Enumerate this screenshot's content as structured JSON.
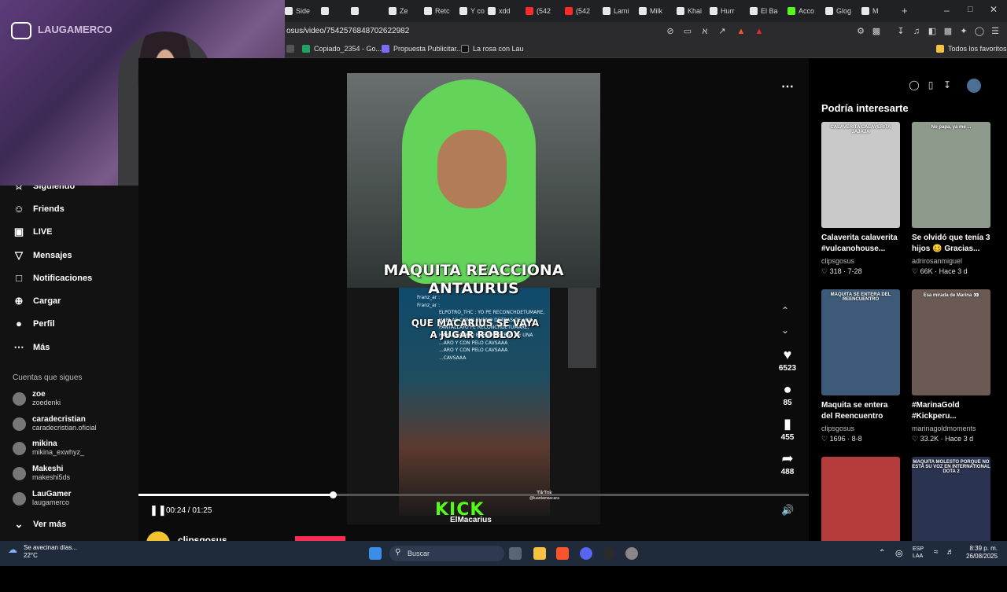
{
  "tabs": [
    {
      "label": "Side",
      "color": "#e8e8e8"
    },
    {
      "label": "",
      "color": "#e8e8e8"
    },
    {
      "label": "",
      "color": "#e8e8e8"
    },
    {
      "label": "Ze",
      "color": "#e8e8e8"
    },
    {
      "label": "Retc",
      "color": "#e8e8e8"
    },
    {
      "label": "Y co",
      "color": "#e8e8e8"
    },
    {
      "label": "xdd",
      "color": "#e8e8e8"
    },
    {
      "label": "(542",
      "color": "#ff2a2a"
    },
    {
      "label": "(542",
      "color": "#ff2a2a"
    },
    {
      "label": "Lami",
      "color": "#e8e8e8"
    },
    {
      "label": "Milk",
      "color": "#e8e8e8"
    },
    {
      "label": "Khai",
      "color": "#e8e8e8"
    },
    {
      "label": "Hurr",
      "color": "#e8e8e8"
    },
    {
      "label": "El Ba",
      "color": "#e8e8e8"
    },
    {
      "label": "Acco",
      "color": "#53fc18"
    },
    {
      "label": "Glog",
      "color": "#e8e8e8"
    },
    {
      "label": "M",
      "color": "#e8e8e8"
    }
  ],
  "browser": {
    "url": "osus/video/7542576848702622982",
    "bookmarks": [
      "Copiado_2354 - Go...",
      "Propuesta Publicitar...",
      "La rosa con Lau"
    ],
    "all_bookmarks": "Todos los favoritos"
  },
  "webcam": {
    "handle": "LAUGAMERCO"
  },
  "sidebar": {
    "partial_item": "Siguiendo",
    "items": [
      {
        "icon": "☺",
        "label": "Friends"
      },
      {
        "icon": "▣",
        "label": "LIVE"
      },
      {
        "icon": "▽",
        "label": "Mensajes"
      },
      {
        "icon": "□",
        "label": "Notificaciones"
      },
      {
        "icon": "⊕",
        "label": "Cargar"
      },
      {
        "icon": "●",
        "label": "Perfil"
      },
      {
        "icon": "⋯",
        "label": "Más"
      }
    ],
    "following_title": "Cuentas que sigues",
    "accounts": [
      {
        "name": "zoe",
        "handle": "zoedenki"
      },
      {
        "name": "caradecristian",
        "handle": "caradecristian.oficial"
      },
      {
        "name": "mikina",
        "handle": "mikina_exwhyz_"
      },
      {
        "name": "Makeshi",
        "handle": "makeshi5ds"
      },
      {
        "name": "LauGamer",
        "handle": "laugamerco"
      }
    ],
    "see_more": "Ver más"
  },
  "video": {
    "title_line1": "MAQUITA REACCIONA",
    "title_line2": "ANTAURUS",
    "subtitle_line1": "QUE MACARIUS SE VAYA",
    "subtitle_line2": "A JUGAR ROBLOX",
    "chat_lines": [
      "Franz_ar :",
      "Franz_ar :",
      "ELPOTRO_THC : YO PE RECONCHDETUMARE,",
      "HABLAS COMO BUENO DETRAS DE UNA",
      "PANTALLAYO PE RECONCHDETUMARE,",
      "HABLAS COMO BUENO DETRAS DE UNA",
      "...ARO Y CON PELO CAVSAAA",
      "...ARO Y CON PELO CAVSAAA",
      "...CAVSAAA"
    ],
    "kick_logo": "KICK",
    "streamer_name": "ElMacarius",
    "tiktok_mark": "TikTok",
    "tiktok_handle": "@luantamascara",
    "time": "00:24 / 01:25",
    "progress": 0.29
  },
  "actions": [
    {
      "icon": "♥",
      "count": "6523",
      "name": "like-button"
    },
    {
      "icon": "●",
      "count": "85",
      "name": "comment-button"
    },
    {
      "icon": "▮",
      "count": "455",
      "name": "save-button"
    },
    {
      "icon": "➦",
      "count": "488",
      "name": "share-button"
    }
  ],
  "channel": {
    "name": "clipsgosus"
  },
  "rail": {
    "title": "Podría interesarte",
    "cards": [
      {
        "caption": "Calaverita calaverita #vulcanohouse...",
        "author": "clipsgosus",
        "stats": "♡ 318 · 7-28",
        "thumb_text": "CALAVERITA CALAVERITA JAJAJA",
        "bg": "#c9c9c9"
      },
      {
        "caption": "Se olvidó que tenía 3 hijos 🥴 Gracias...",
        "author": "adrirosanmiguel",
        "stats": "♡ 66K · Hace 3 d",
        "thumb_text": "No papa, ya me ...",
        "bg": "#8e9a8c"
      },
      {
        "caption": "Maquita se entera del Reencuentro de...",
        "author": "clipsgosus",
        "stats": "♡ 1696 · 8-8",
        "thumb_text": "MAQUITA SE ENTERA DEL REENCUENTRO",
        "bg": "#3d5a78"
      },
      {
        "caption": "#MarinaGold #Kickperu...",
        "author": "marinagoldmoments",
        "stats": "♡ 33.2K · Hace 3 d",
        "thumb_text": "Esa mirada de Marina 👀",
        "bg": "#6b5a54"
      },
      {
        "caption": "",
        "author": "",
        "stats": "",
        "thumb_text": "",
        "bg": "#b43b3b"
      },
      {
        "caption": "",
        "author": "",
        "stats": "",
        "thumb_text": "MAQUITA MOLESTO PORQUE NO ESTA SU VOZ EN INTERNATIONAL DOTA 2",
        "bg": "#2a3350"
      }
    ]
  },
  "taskbar": {
    "weather_text": "Se avecinan días...",
    "temp": "22°C",
    "search": "Buscar",
    "lang_line1": "ESP",
    "lang_line2": "LAA",
    "time": "8:39 p. m.",
    "date": "26/08/2025"
  }
}
